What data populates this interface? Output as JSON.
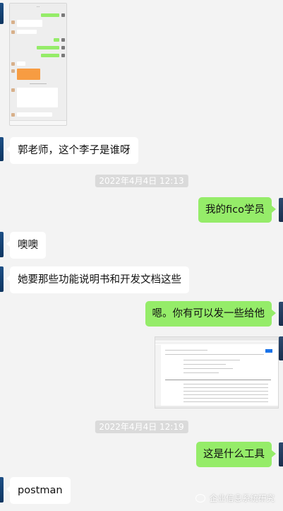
{
  "colors": {
    "background": "#f3f3f3",
    "incoming_bubble": "#ffffff",
    "outgoing_bubble": "#95ec69",
    "timestamp_bg": "#dadada"
  },
  "messages": {
    "m1": "郭老师，这个李子是谁呀",
    "m2": "我的fico学员",
    "m3": "噢噢",
    "m4": "她要那些功能说明书和开发文档这些",
    "m5": "嗯。你有可以发一些给他",
    "m6": "这是什么工具",
    "m7": "postman"
  },
  "timestamps": {
    "t1": "2022年4月4日 12:13",
    "t2": "2022年4月4日 12:19"
  },
  "attachments": {
    "phone_screenshot": "image",
    "desktop_screenshot": "image"
  },
  "watermark": {
    "icon": "wechat-official-account-icon",
    "text": "企业信息系统研究"
  }
}
